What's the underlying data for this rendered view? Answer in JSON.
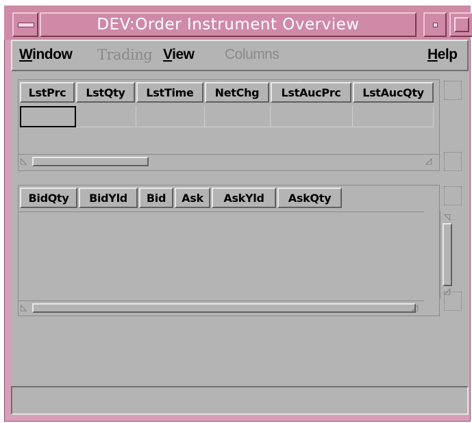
{
  "window": {
    "title": "DEV:Order Instrument Overview"
  },
  "menubar": {
    "items": [
      {
        "label": "Window",
        "mnemonic": "W",
        "rest": "indow",
        "enabled": true
      },
      {
        "label": "Trading",
        "mnemonic": "",
        "rest": "Trading",
        "enabled": false
      },
      {
        "label": "View",
        "mnemonic": "V",
        "rest": "iew",
        "enabled": true
      },
      {
        "label": "Columns",
        "mnemonic": "",
        "rest": "Columns",
        "enabled": false
      },
      {
        "label": "Help",
        "mnemonic": "H",
        "rest": "elp",
        "enabled": true
      }
    ]
  },
  "last_trade_table": {
    "columns": [
      "LstPrc",
      "LstQty",
      "LstTime",
      "NetChg",
      "LstAucPrc",
      "LstAucQty"
    ]
  },
  "order_book_table": {
    "columns": [
      "BidQty",
      "BidYld",
      "Bid",
      "Ask",
      "AskYld",
      "AskQty"
    ]
  },
  "colors": {
    "titlebar": "#cf8aa6",
    "background": "#b4b4b4"
  }
}
